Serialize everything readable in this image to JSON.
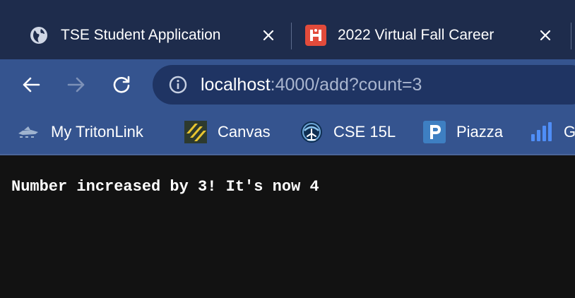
{
  "tabs": [
    {
      "title": "TSE Student Application",
      "favicon": "globe-icon"
    },
    {
      "title": "2022 Virtual Fall Career",
      "favicon": "handshake-icon"
    }
  ],
  "address_bar": {
    "host": "localhost",
    "rest": ":4000/add?count=3"
  },
  "bookmarks": [
    {
      "label": "My TritonLink",
      "icon": "tritonlink-icon"
    },
    {
      "label": "Canvas",
      "icon": "canvas-icon"
    },
    {
      "label": "CSE 15L",
      "icon": "cse15l-icon"
    },
    {
      "label": "Piazza",
      "icon": "piazza-icon"
    },
    {
      "label": "G",
      "icon": "bar-chart-icon"
    }
  ],
  "page": {
    "message": "Number increased by 3! It's now 4"
  },
  "colors": {
    "tabstrip_bg": "#1e2c4c",
    "toolbar_bg": "#35548f",
    "omnibox_bg": "#1f3463",
    "page_bg": "#121212",
    "handshake_red": "#e24b3b",
    "canvas_yellow": "#e8c52f",
    "piazza_blue": "#3e7fc2",
    "chart_blue": "#4f8ef7"
  }
}
